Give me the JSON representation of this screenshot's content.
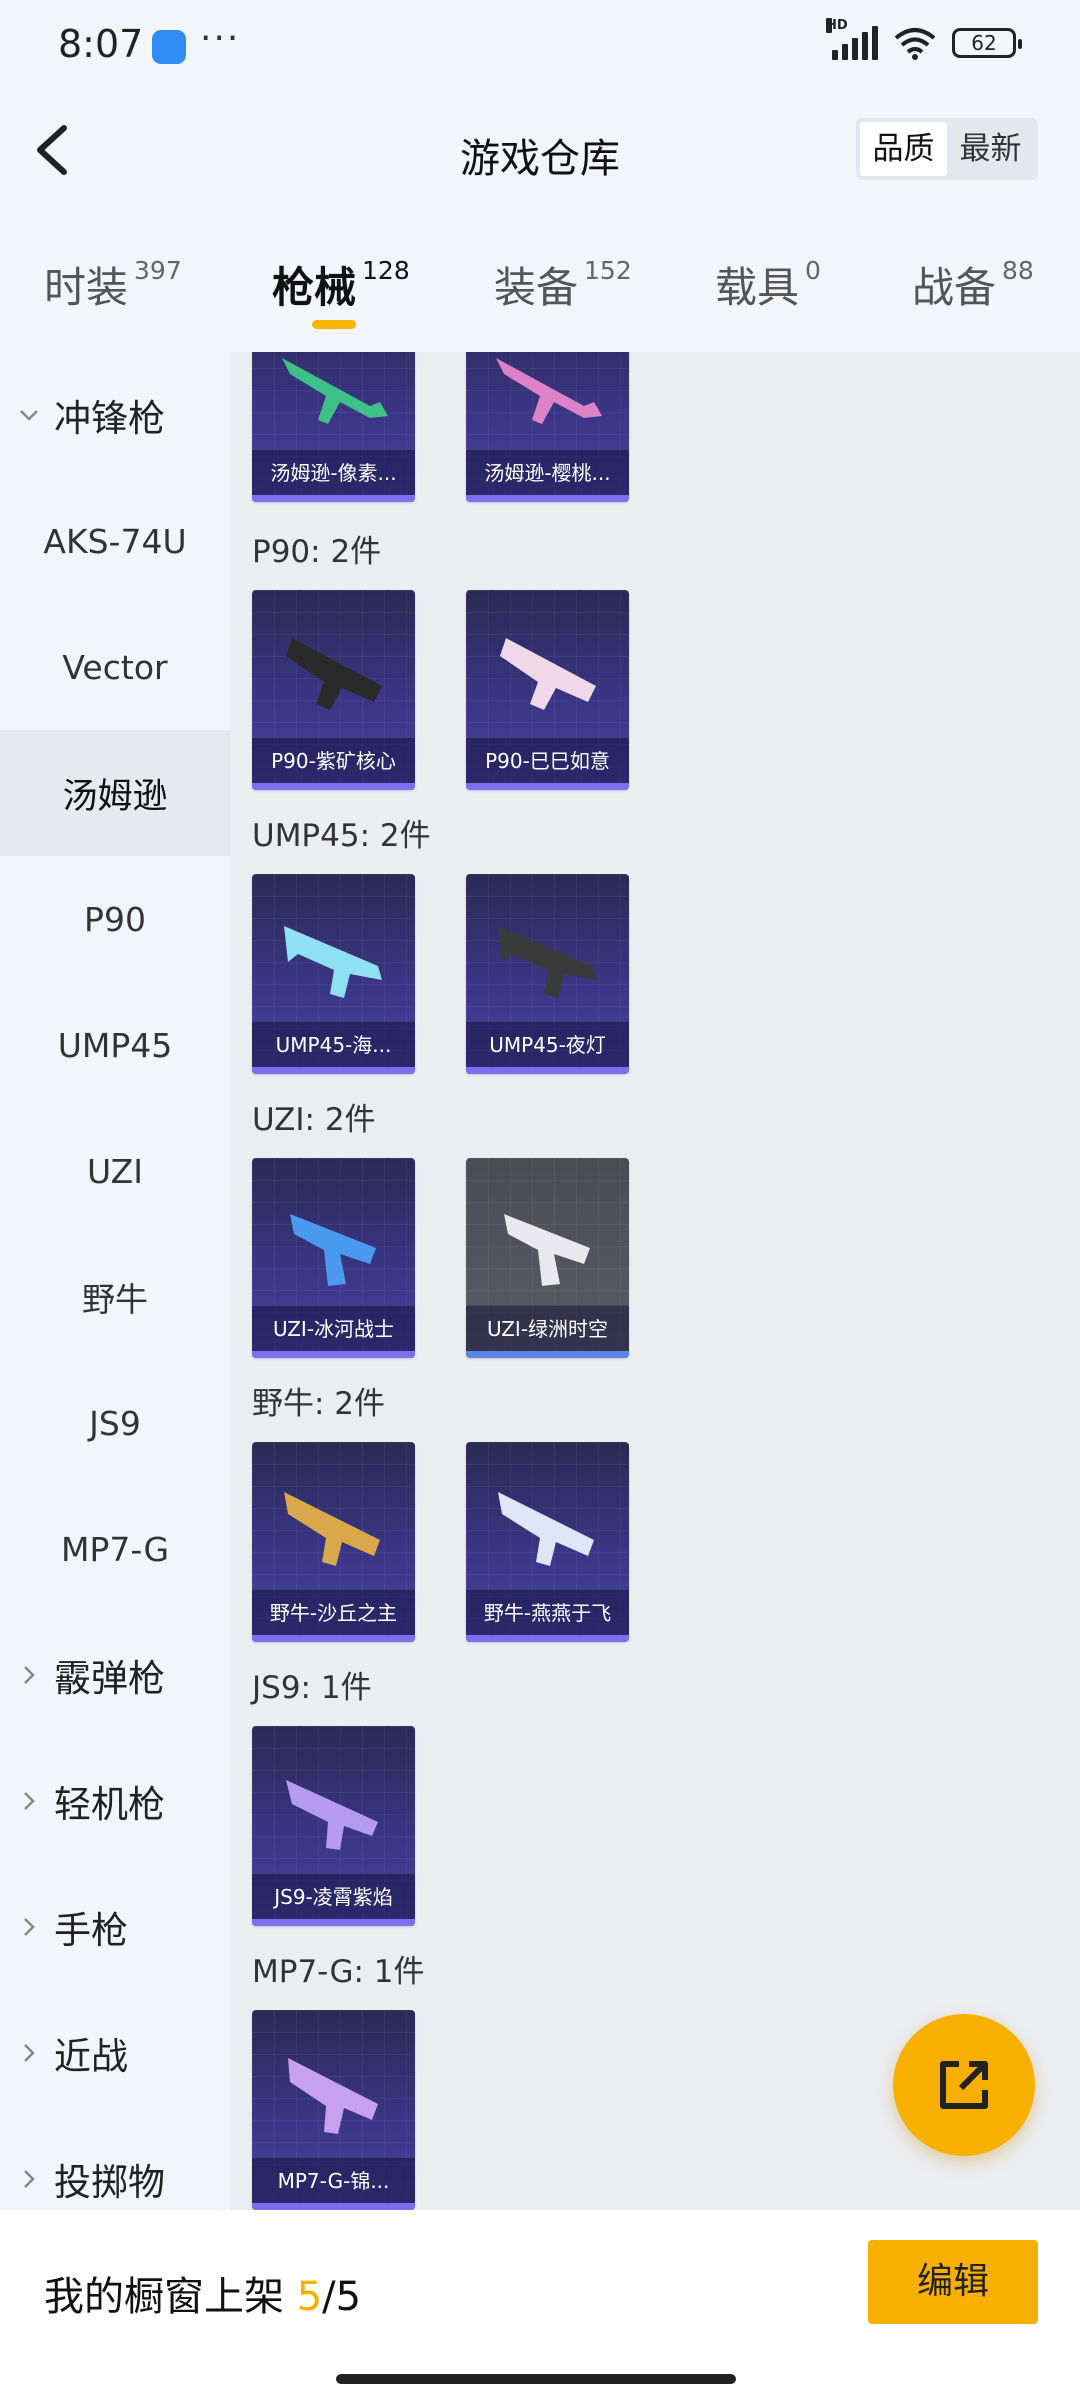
{
  "status_bar": {
    "time": "8:07",
    "more": "···",
    "network": "HD",
    "battery": "62"
  },
  "header": {
    "title": "游戏仓库",
    "sort_options": [
      {
        "label": "品质",
        "active": true
      },
      {
        "label": "最新",
        "active": false
      }
    ]
  },
  "tabs": [
    {
      "label": "时装",
      "count": "397"
    },
    {
      "label": "枪械",
      "count": "128",
      "active": true
    },
    {
      "label": "装备",
      "count": "152"
    },
    {
      "label": "载具",
      "count": "0"
    },
    {
      "label": "战备",
      "count": "88"
    }
  ],
  "sidebar": {
    "items": [
      {
        "label": "冲锋枪",
        "type": "group",
        "expanded": true
      },
      {
        "label": "AKS-74U"
      },
      {
        "label": "Vector"
      },
      {
        "label": "汤姆逊",
        "active": true
      },
      {
        "label": "P90"
      },
      {
        "label": "UMP45"
      },
      {
        "label": "UZI"
      },
      {
        "label": "野牛"
      },
      {
        "label": "JS9"
      },
      {
        "label": "MP7-G"
      },
      {
        "label": "霰弹枪",
        "type": "group"
      },
      {
        "label": "轻机枪",
        "type": "group"
      },
      {
        "label": "手枪",
        "type": "group"
      },
      {
        "label": "近战",
        "type": "group"
      },
      {
        "label": "投掷物",
        "type": "group"
      }
    ]
  },
  "sections": [
    {
      "title": "",
      "items": [
        {
          "name": "汤姆逊-像素...",
          "color": "#3ed08a"
        },
        {
          "name": "汤姆逊-樱桃...",
          "color": "#f08ad0"
        }
      ]
    },
    {
      "title": "P90: 2件",
      "items": [
        {
          "name": "P90-紫矿核心",
          "color": "#2a2a2a"
        },
        {
          "name": "P90-巳巳如意",
          "color": "#f0d8e8"
        }
      ]
    },
    {
      "title": "UMP45: 2件",
      "items": [
        {
          "name": "UMP45-海...",
          "color": "#8fe0f0"
        },
        {
          "name": "UMP45-夜灯",
          "color": "#3a3a3a"
        }
      ]
    },
    {
      "title": "UZI: 2件",
      "items": [
        {
          "name": "UZI-冰河战士",
          "color": "#4a9af0"
        },
        {
          "name": "UZI-绿洲时空",
          "color": "#e8e8ee",
          "gray": true
        }
      ]
    },
    {
      "title": "野牛: 2件",
      "items": [
        {
          "name": "野牛-沙丘之主",
          "color": "#d8a84a"
        },
        {
          "name": "野牛-燕燕于飞",
          "color": "#dfe6f5"
        }
      ]
    },
    {
      "title": "JS9: 1件",
      "items": [
        {
          "name": "JS9-凌霄紫焰",
          "color": "#b59af0"
        }
      ]
    },
    {
      "title": "MP7-G: 1件",
      "items": [
        {
          "name": "MP7-G-锦...",
          "color": "#c8a0f0"
        }
      ]
    }
  ],
  "bottom_bar": {
    "showcase_label": "我的橱窗上架",
    "showcase_count": "5",
    "showcase_sep": "/",
    "showcase_total": "5",
    "edit_label": "编辑"
  }
}
